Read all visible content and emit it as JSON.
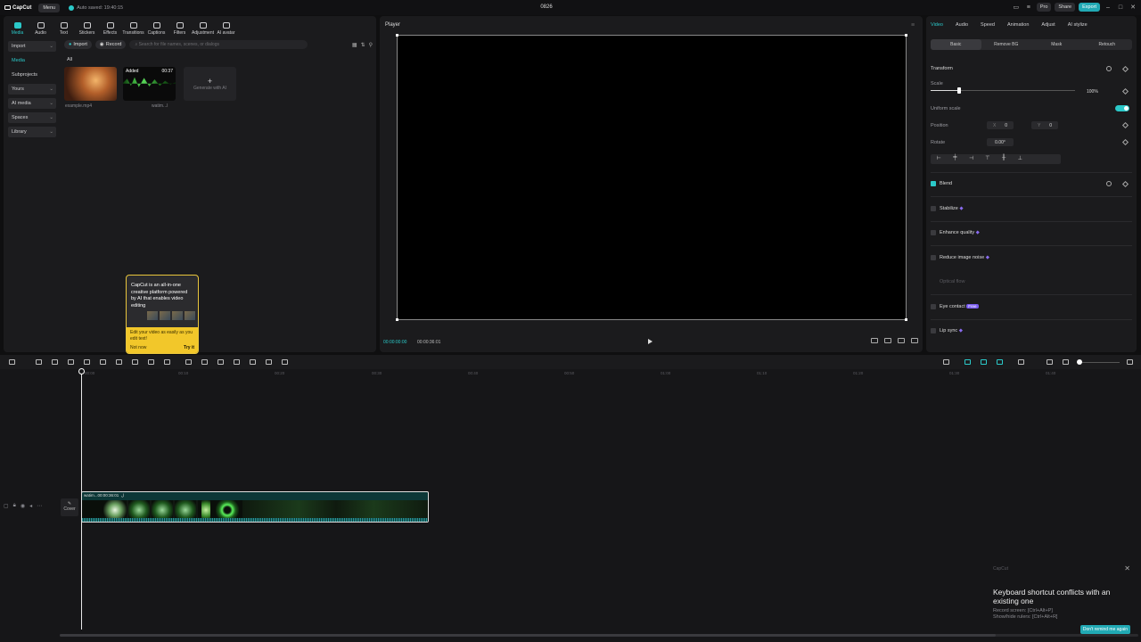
{
  "app": {
    "name": "CapCut",
    "menu": "Menu",
    "saved": "Auto saved: 19:40:15",
    "title": "0826"
  },
  "topbar": {
    "pro": "Pro",
    "share": "Share",
    "export": "Export"
  },
  "tools": [
    "Media",
    "Audio",
    "Text",
    "Stickers",
    "Effects",
    "Transitions",
    "Captions",
    "Filters",
    "Adjustment",
    "AI avatar"
  ],
  "sidenav": {
    "import": "Import",
    "media": "Media",
    "subprojects": "Subprojects",
    "yours": "Yours",
    "ai_media": "AI media",
    "spaces": "Spaces",
    "library": "Library"
  },
  "media": {
    "import_btn": "Import",
    "record_btn": "Record",
    "search_placeholder": "Search for file names, scenes, or dialogs",
    "all": "All",
    "items": [
      {
        "caption": "example.mp4"
      },
      {
        "caption": "watim...l",
        "added": "Added",
        "duration": "00:37"
      }
    ],
    "generate": "Generate with AI"
  },
  "tooltip": {
    "text": "CapCut is an all-in-one creative platform powered by AI that enables video editing",
    "sub": "Edit your video as easily as you edit text!",
    "not_now": "Not now",
    "try_it": "Try it"
  },
  "player": {
    "title": "Player",
    "current": "00:00:00:00",
    "total": "00:00:36:01"
  },
  "right": {
    "tabs": [
      "Video",
      "Audio",
      "Speed",
      "Animation",
      "Adjust",
      "AI stylize"
    ],
    "subtabs": [
      "Basic",
      "Remove BG",
      "Mask",
      "Retouch"
    ],
    "transform": "Transform",
    "scale": "Scale",
    "scale_val": "100%",
    "scale_level": 0.2,
    "uniform": "Uniform scale",
    "position": "Position",
    "pos_x_label": "X",
    "pos_x": "0",
    "pos_y_label": "Y",
    "pos_y": "0",
    "rotate": "Rotate",
    "rotate_val": "0.00°",
    "blend": "Blend",
    "stabilize": "Stabilize",
    "enhance": "Enhance quality",
    "reduce": "Reduce image noise",
    "optical": "Optical flow",
    "eye": "Eye contact",
    "eye_badge": "Free",
    "lipsync": "Lip sync"
  },
  "timeline": {
    "ticks": [
      "00:00",
      "00:10",
      "00:20",
      "00:30",
      "00:40",
      "00:50",
      "01:00",
      "01:10",
      "01:20",
      "01:30",
      "01:40"
    ],
    "clip_name": "watim...ل",
    "clip_duration": "00:00:36:01",
    "cover": "Cover"
  },
  "notification": {
    "source": "CapCut",
    "heading": "Keyboard shortcut conflicts with an existing one",
    "line1": "Record screen: [Ctrl+Alt+P]",
    "line2": "Show/hide rulers: [Ctrl+Alt+R]",
    "button": "Don't remind me again"
  }
}
